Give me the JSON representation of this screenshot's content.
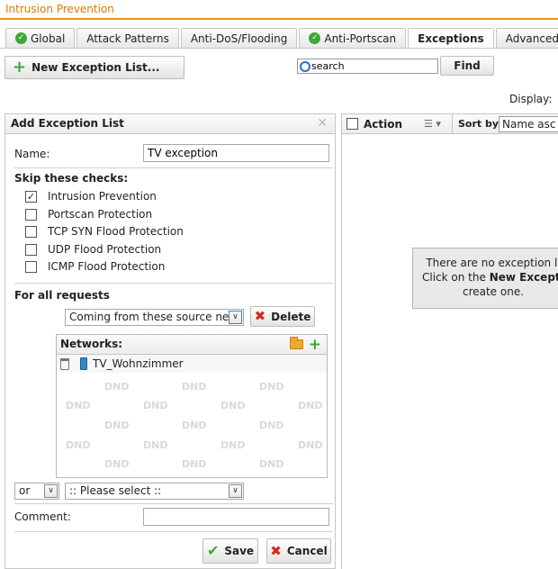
{
  "app": {
    "title": "Intrusion Prevention"
  },
  "tabs": [
    {
      "label": "Global",
      "status": "ok"
    },
    {
      "label": "Attack Patterns",
      "status": ""
    },
    {
      "label": "Anti-DoS/Flooding",
      "status": ""
    },
    {
      "label": "Anti-Portscan",
      "status": "ok"
    },
    {
      "label": "Exceptions",
      "status": "",
      "active": true
    },
    {
      "label": "Advanced",
      "status": ""
    }
  ],
  "toolbar": {
    "new_list_label": "New Exception List...",
    "search_value": "search",
    "find_label": "Find",
    "display_label": "Display:"
  },
  "form": {
    "title": "Add Exception List",
    "name_label": "Name:",
    "name_value": "TV exception",
    "skip_title": "Skip these checks:",
    "checks": [
      {
        "label": "Intrusion Prevention",
        "checked": true
      },
      {
        "label": "Portscan Protection",
        "checked": false
      },
      {
        "label": "TCP SYN Flood Protection",
        "checked": false
      },
      {
        "label": "UDP Flood Protection",
        "checked": false
      },
      {
        "label": "ICMP Flood Protection",
        "checked": false
      }
    ],
    "for_all_title": "For all requests",
    "condition_value": "Coming from these source netw",
    "delete_label": "Delete",
    "networks_title": "Networks:",
    "network_items": [
      "TV_Wohnzimmer"
    ],
    "dnd_label": "DND",
    "or_value": "or",
    "please_select_value": ":: Please select ::",
    "comment_label": "Comment:",
    "comment_value": "",
    "save_label": "Save",
    "cancel_label": "Cancel"
  },
  "list": {
    "action_label": "Action",
    "sortby_label": "Sort by:",
    "sort_value": "Name asc",
    "empty_line1": "There are no exception li",
    "empty_line2_prefix": "Click on the ",
    "empty_line2_bold": "New Exception",
    "empty_line3": "create one."
  },
  "colors": {
    "accent": "#e8901e",
    "ok": "#3aaa35",
    "danger": "#d42a20"
  }
}
